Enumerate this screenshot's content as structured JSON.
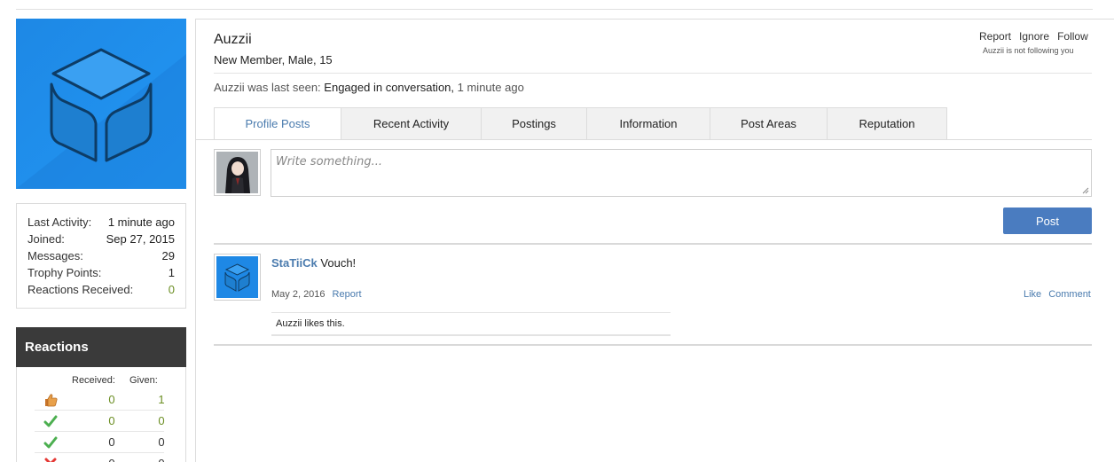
{
  "profile": {
    "username": "Auzzii",
    "user_title": "New Member, Male, 15",
    "last_seen_prefix": "Auzzii was last seen:",
    "last_seen_activity": "Engaged in conversation,",
    "last_seen_time": "1 minute ago",
    "links": {
      "report": "Report",
      "ignore": "Ignore",
      "follow": "Follow"
    },
    "following_note": "Auzzii is not following you"
  },
  "stats": [
    {
      "label": "Last Activity:",
      "value": "1 minute ago"
    },
    {
      "label": "Joined:",
      "value": "Sep 27, 2015"
    },
    {
      "label": "Messages:",
      "value": "29"
    },
    {
      "label": "Trophy Points:",
      "value": "1"
    },
    {
      "label": "Reactions Received:",
      "value": "0"
    }
  ],
  "reactions": {
    "title": "Reactions",
    "received_header": "Received:",
    "given_header": "Given:",
    "rows": [
      {
        "icon": "thumbs-up-icon",
        "received": "0",
        "given": "1"
      },
      {
        "icon": "check-icon",
        "received": "0",
        "given": "0"
      },
      {
        "icon": "check-icon",
        "received": "0",
        "given": "0"
      },
      {
        "icon": "x-icon",
        "received": "0",
        "given": "0"
      }
    ]
  },
  "tabs": [
    {
      "label": "Profile Posts",
      "active": true
    },
    {
      "label": "Recent Activity"
    },
    {
      "label": "Postings"
    },
    {
      "label": "Information"
    },
    {
      "label": "Post Areas"
    },
    {
      "label": "Reputation"
    }
  ],
  "composer": {
    "placeholder": "Write something...",
    "post_button": "Post"
  },
  "post": {
    "author": "StaTiiCk",
    "message": "Vouch!",
    "date": "May 2, 2016",
    "report": "Report",
    "like": "Like",
    "comment": "Comment",
    "likes_text": "Auzzii likes this."
  },
  "colors": {
    "accent": "#4a7bae",
    "brand_blue": "#1e88e5",
    "post_button": "#4a7cc0",
    "green": "#6b8e23",
    "reactions_header": "#3a3a3a"
  }
}
